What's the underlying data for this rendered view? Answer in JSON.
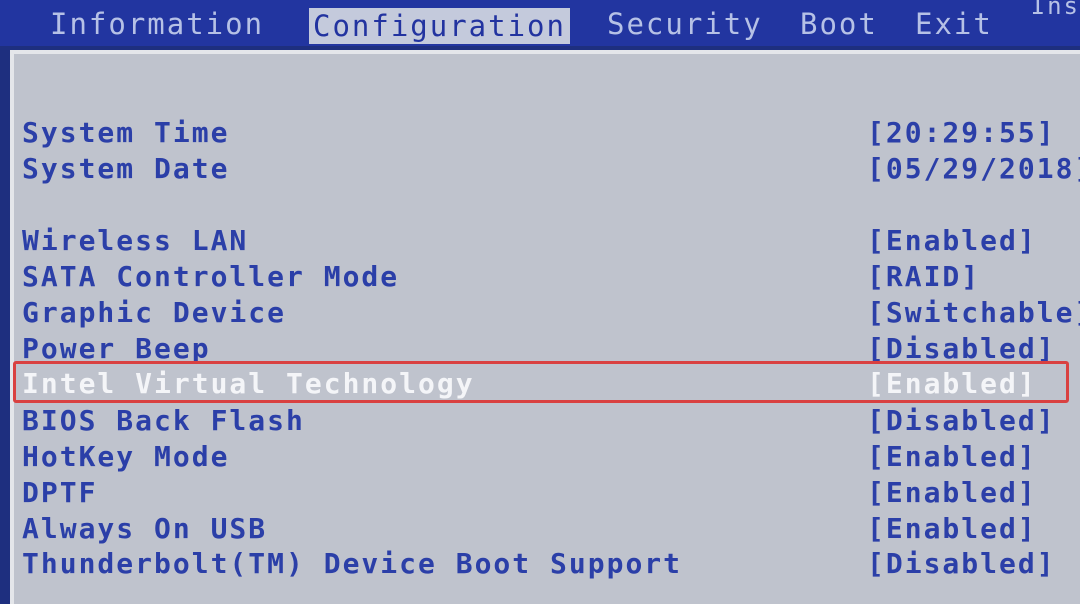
{
  "menu": {
    "tabs": [
      {
        "label": "Information"
      },
      {
        "label": "Configuration"
      },
      {
        "label": "Security"
      },
      {
        "label": "Boot"
      },
      {
        "label": "Exit"
      }
    ],
    "corner_text": "Ins"
  },
  "settings": [
    {
      "label": "System Time",
      "value": "[20:29:55]"
    },
    {
      "label": "System Date",
      "value": "[05/29/2018]"
    },
    {
      "label": "Wireless LAN",
      "value": "[Enabled]"
    },
    {
      "label": "SATA Controller Mode",
      "value": "[RAID]"
    },
    {
      "label": "Graphic Device",
      "value": "[Switchable]"
    },
    {
      "label": "Power Beep",
      "value": "[Disabled]"
    },
    {
      "label": "Intel Virtual Technology",
      "value": "[Enabled]"
    },
    {
      "label": "BIOS Back Flash",
      "value": "[Disabled]"
    },
    {
      "label": "HotKey Mode",
      "value": "[Enabled]"
    },
    {
      "label": "DPTF",
      "value": "[Enabled]"
    },
    {
      "label": "Always On USB",
      "value": "[Enabled]"
    },
    {
      "label": "Thunderbolt(TM) Device Boot Support",
      "value": "[Disabled]"
    }
  ],
  "colors": {
    "menubar": "#2235a0",
    "panel": "#bfc3cd",
    "text_blue": "#2b3fa8",
    "highlight_text": "#f4f5f8",
    "callout_red": "#d94141"
  }
}
